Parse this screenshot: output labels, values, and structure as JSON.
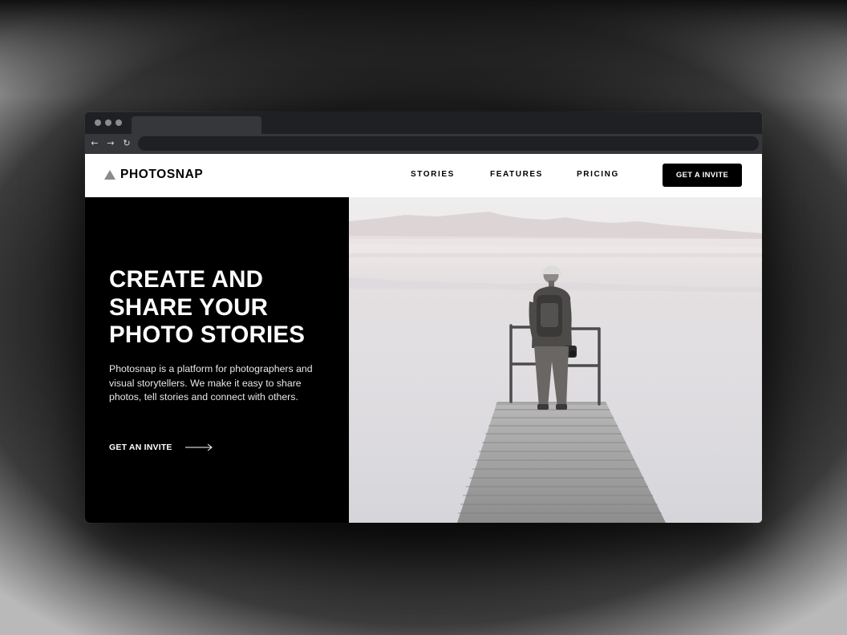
{
  "browser": {
    "back_icon": "←",
    "forward_icon": "→",
    "reload_icon": "↻"
  },
  "site": {
    "logo_text": "PHOTOSNAP",
    "nav": [
      {
        "label": "STORIES"
      },
      {
        "label": "FEATURES"
      },
      {
        "label": "PRICING"
      }
    ],
    "cta_label": "GET A INVITE"
  },
  "hero": {
    "title_lines": [
      "CREATE AND",
      "SHARE YOUR",
      "PHOTO STORIES"
    ],
    "description": "Photosnap is a platform for photographers and visual storytellers. We make it easy to share photos, tell stories and connect with others.",
    "link_label": "GET AN INVITE"
  },
  "colors": {
    "hero_background": "#000000",
    "cta_background": "#000000",
    "logo_mark": "#8a8a8a"
  },
  "icons": {
    "logo": "triangle-logo-icon",
    "arrow": "arrow-right-icon"
  }
}
